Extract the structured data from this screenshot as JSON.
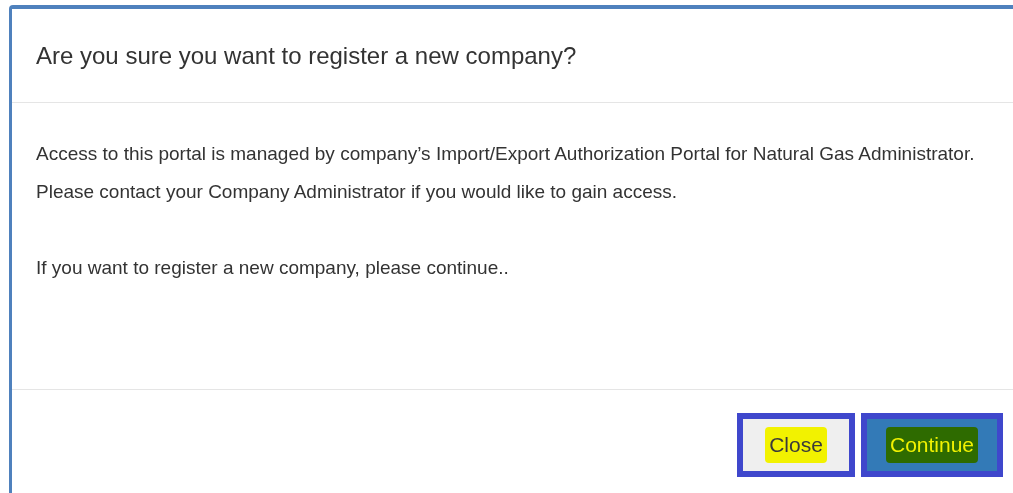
{
  "dialog": {
    "title": "Are you sure you want to register a new company?",
    "paragraphs": [
      "Access to this portal is managed by company’s Import/Export Authorization Portal for Natural Gas Administrator. Please contact your Company Administrator if you would like to gain access.",
      "If you want to register a new company, please continue.."
    ],
    "buttons": [
      {
        "label": "Close",
        "kind": "default"
      },
      {
        "label": "Continue",
        "kind": "primary"
      }
    ]
  }
}
